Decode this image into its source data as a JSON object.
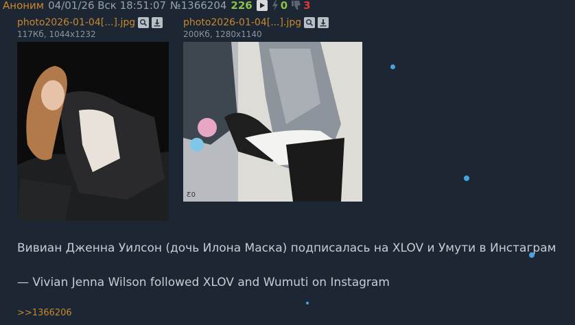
{
  "post": {
    "author": "Аноним",
    "datetime": "04/01/26 Вск 18:51:07",
    "number": "№1366204",
    "count": "226",
    "votes_up": "0",
    "votes_down": "3"
  },
  "files": [
    {
      "name": "photo2026-01-04[...].jpg",
      "info": "117Кб, 1044x1232"
    },
    {
      "name": "photo2026-01-04[...].jpg",
      "info": "200Кб, 1280x1140"
    }
  ],
  "body": {
    "line1": "Вивиан Дженна Уилсон (дочь Илона Маска) подписалась на XLOV и Умути в Инстаграм",
    "line2": "— Vivian Jenna Wilson followed XLOV and Wumuti on Instagram"
  },
  "reply": ">>1366206",
  "icons": {
    "play": "play-icon",
    "upvote": "lightning-icon",
    "downvote": "thumbs-down-icon",
    "search": "magnifier-icon",
    "download": "download-icon"
  },
  "colors": {
    "background": "#1c2733",
    "accent": "#c9882e",
    "count": "#8bc34a",
    "downvote": "#e53935",
    "dot": "#4aa3df"
  }
}
